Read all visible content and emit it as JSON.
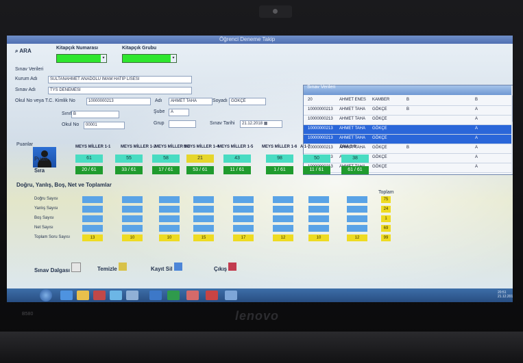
{
  "brand": "lenovo",
  "model": "B580",
  "window": {
    "title": "Öğrenci Deneme Takip"
  },
  "search": {
    "label": "ARA",
    "booklet_no_label": "Kitapçık Numarası",
    "booklet_type_label": "Kitapçık Grubu"
  },
  "exam_info": {
    "section_label": "Sınav Verileri",
    "school_label": "Kurum Adı",
    "school_value": "SULTANAHMET ANADOLU İMAM HATİP LİSESİ",
    "exam_name_label": "Sınav Adı",
    "exam_name_value": "TYS DENEMESİ",
    "tc_label": "Okul No veya T.C. Kimlik No",
    "tc_value": "10000000213",
    "name_label": "Adı",
    "name_value": "AHMET TAHA",
    "surname_label": "Soyadı",
    "surname_value": "GÖKÇE",
    "class_label": "Sınıf",
    "class_value": "B",
    "branch_label": "Şube",
    "branch_value": "A",
    "student_no_label": "Okul No",
    "student_no_value": "00001",
    "group_label": "Grup",
    "date_label": "Sınav Tarihi",
    "date_value": "21.12.2018"
  },
  "grid": {
    "title": "Sınav Verileri",
    "rows": [
      {
        "no": "20",
        "name": "AHMET ENES",
        "surname": "KAMBER",
        "c1": "B",
        "c2": "B",
        "selected": false
      },
      {
        "no": "10000000213",
        "name": "AHMET TAHA",
        "surname": "GÖKÇE",
        "c1": "B",
        "c2": "A",
        "selected": false
      },
      {
        "no": "10000000213",
        "name": "AHMET TAHA",
        "surname": "GÖKÇE",
        "c1": "",
        "c2": "A",
        "selected": false
      },
      {
        "no": "10000000213",
        "name": "AHMET TAHA",
        "surname": "GÖKÇE",
        "c1": "",
        "c2": "A",
        "selected": true
      },
      {
        "no": "10000000213",
        "name": "AHMET TAHA",
        "surname": "GÖKÇE",
        "c1": "",
        "c2": "A",
        "selected": true
      },
      {
        "no": "10000000213",
        "name": "AHMET TAHA",
        "surname": "GÖKÇE",
        "c1": "B",
        "c2": "A",
        "selected": false
      },
      {
        "no": "10000000213",
        "name": "AHMET TAHA",
        "surname": "GÖKÇE",
        "c1": "",
        "c2": "A",
        "selected": false
      },
      {
        "no": "10000000213",
        "name": "AHMET TAHA",
        "surname": "GÖKÇE",
        "c1": "",
        "c2": "A",
        "selected": false
      }
    ]
  },
  "tests": {
    "section_label": "Puanlar",
    "headers": [
      "MEYS MİLLER 1-1",
      "MEYS MİLLER 1-2",
      "MEYS MİLLER 1-3",
      "MEYS MİLLER 1-4",
      "MEYS MİLLER 1-5",
      "MEYS MİLLER 1-6",
      "A 1-7",
      "DNA 1-8"
    ],
    "puan_label": "Puan",
    "puan_values": [
      "61",
      "55",
      "58",
      "21",
      "43",
      "98",
      "50",
      "38"
    ],
    "sira_label": "Sıra",
    "sira_values": [
      "20 / 61",
      "33 / 61",
      "17 / 61",
      "53 / 61",
      "11 / 61",
      "1 / 61",
      "11 / 61",
      "61 / 61"
    ]
  },
  "answers": {
    "section_label": "Doğru, Yanlış, Boş, Net ve Toplamlar",
    "total_header": "Toplam",
    "row_labels": [
      "Doğru Sayısı",
      "Yanlış Sayısı",
      "Boş Sayısı",
      "Net Sayısı",
      "Toplam Soru Sayısı"
    ],
    "totals": [
      "75",
      "24",
      "1",
      "69",
      "99"
    ],
    "question_counts": [
      "13",
      "10",
      "10",
      "15",
      "17",
      "12",
      "10",
      "12"
    ]
  },
  "bottom": {
    "answer_key_label": "Sınav Dalgası",
    "clear_label": "Temizle",
    "score_label": "Kayıt Sil",
    "exit_label": "Çıkış"
  },
  "taskbar": {
    "clock": "20:51 21.12.2018"
  }
}
